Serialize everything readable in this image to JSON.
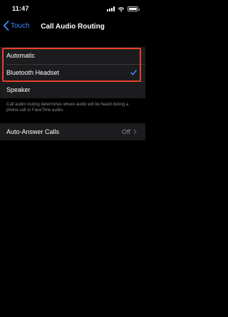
{
  "status_bar": {
    "time": "11:47"
  },
  "nav": {
    "back_label": "Touch",
    "title": "Call Audio Routing"
  },
  "routing": {
    "options": [
      {
        "label": "Automatic",
        "selected": false
      },
      {
        "label": "Bluetooth Headset",
        "selected": true
      },
      {
        "label": "Speaker",
        "selected": false
      }
    ],
    "footer": "Call audio routing determines where audio will be heard during a phone call or FaceTime audio."
  },
  "auto_answer": {
    "label": "Auto-Answer Calls",
    "value": "Off"
  },
  "colors": {
    "accent": "#3d8bfd",
    "highlight": "#e8402a",
    "cell": "#1c1c1e",
    "secondary": "#8d8d93"
  },
  "icons": [
    "cellular-signal-icon",
    "wifi-icon",
    "battery-icon",
    "chevron-left-icon",
    "checkmark-icon",
    "chevron-right-icon"
  ]
}
